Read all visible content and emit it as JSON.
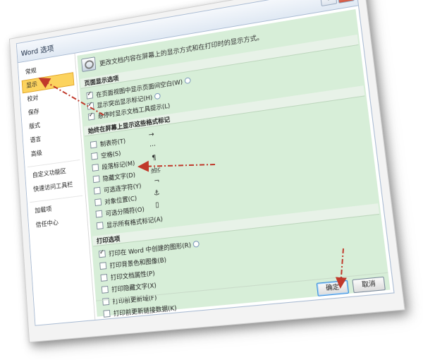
{
  "window": {
    "title": "Word 选项",
    "controls": {
      "help": "?",
      "close": "✕"
    }
  },
  "sidebar": {
    "items": [
      {
        "label": "常规"
      },
      {
        "label": "显示",
        "active": true
      },
      {
        "label": "校对"
      },
      {
        "label": "保存"
      },
      {
        "label": "版式"
      },
      {
        "label": "语言"
      },
      {
        "label": "高级"
      },
      {
        "label": "自定义功能区"
      },
      {
        "label": "快速访问工具栏"
      },
      {
        "label": "加载项"
      },
      {
        "label": "信任中心"
      }
    ]
  },
  "main": {
    "header_icon": "monitor-icon",
    "header_text": "更改文档内容在屏幕上的显示方式和在打印时的显示方式。",
    "page_display": {
      "title": "页面显示选项",
      "options": [
        {
          "label": "在页面视图中显示页面间空白(W)",
          "checked": true,
          "info": true
        },
        {
          "label": "显示突出显示标记(H)",
          "checked": true,
          "info": true
        },
        {
          "label": "悬停时显示文档工具提示(L)",
          "checked": true,
          "info": false
        }
      ]
    },
    "formatting_marks": {
      "title": "始终在屏幕上显示这些格式标记",
      "options": [
        {
          "label": "制表符(T)",
          "checked": false,
          "symbol": "→"
        },
        {
          "label": "空格(S)",
          "checked": false,
          "symbol": "···"
        },
        {
          "label": "段落标记(M)",
          "checked": false,
          "symbol": "¶"
        },
        {
          "label": "隐藏文字(D)",
          "checked": false,
          "symbol": "abc"
        },
        {
          "label": "可选连字符(Y)",
          "checked": false,
          "symbol": "¬"
        },
        {
          "label": "对象位置(C)",
          "checked": false,
          "symbol": "⚓"
        },
        {
          "label": "可选分隔符(O)",
          "checked": false,
          "symbol": "▯"
        },
        {
          "label": "显示所有格式标记(A)",
          "checked": false,
          "symbol": ""
        }
      ]
    },
    "printing": {
      "title": "打印选项",
      "options": [
        {
          "label": "打印在 Word 中创建的图形(R)",
          "checked": true,
          "info": true
        },
        {
          "label": "打印背景色和图像(B)",
          "checked": false
        },
        {
          "label": "打印文档属性(P)",
          "checked": false
        },
        {
          "label": "打印隐藏文字(X)",
          "checked": false
        },
        {
          "label": "打印前更新域(F)",
          "checked": false
        },
        {
          "label": "打印前更新链接数据(K)",
          "checked": false
        }
      ]
    }
  },
  "buttons": {
    "ok": "确定",
    "cancel": "取消"
  },
  "colors": {
    "panel_bg": "#d7eed8",
    "active_nav": "#fcd35e",
    "annotation_arrow": "#c0392b"
  }
}
